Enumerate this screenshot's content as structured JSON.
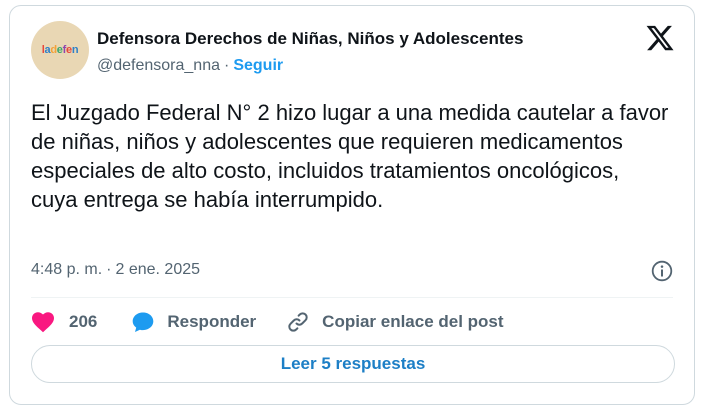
{
  "author": {
    "display_name": "Defensora Derechos de Niñas, Niños y Adolescentes",
    "handle": "@defensora_nna",
    "separator": "·",
    "follow_label": "Seguir",
    "avatar_logo_text": "ladefen"
  },
  "post": {
    "text": "El Juzgado Federal N° 2 hizo lugar a una medida cautelar a favor de niñas, niños y adolescentes que requieren medicamentos especiales de alto costo, incluidos tratamientos oncológicos, cuya entrega se había interrumpido.",
    "time": "4:48 p. m.",
    "separator": "·",
    "date": "2 ene. 2025"
  },
  "actions": {
    "like_count": "206",
    "reply_label": "Responder",
    "copy_link_label": "Copiar enlace del post"
  },
  "replies_button_label": "Leer 5 respuestas",
  "icons": {
    "brand": "x-logo-icon",
    "info": "info-icon",
    "like": "heart-icon",
    "reply": "speech-bubble-icon",
    "copy": "link-icon"
  },
  "colors": {
    "accent": "#1d9bf0",
    "heart": "#f91880",
    "reply_bubble": "#1d9bf0",
    "muted_text": "#536471",
    "border": "#cfd9de"
  }
}
